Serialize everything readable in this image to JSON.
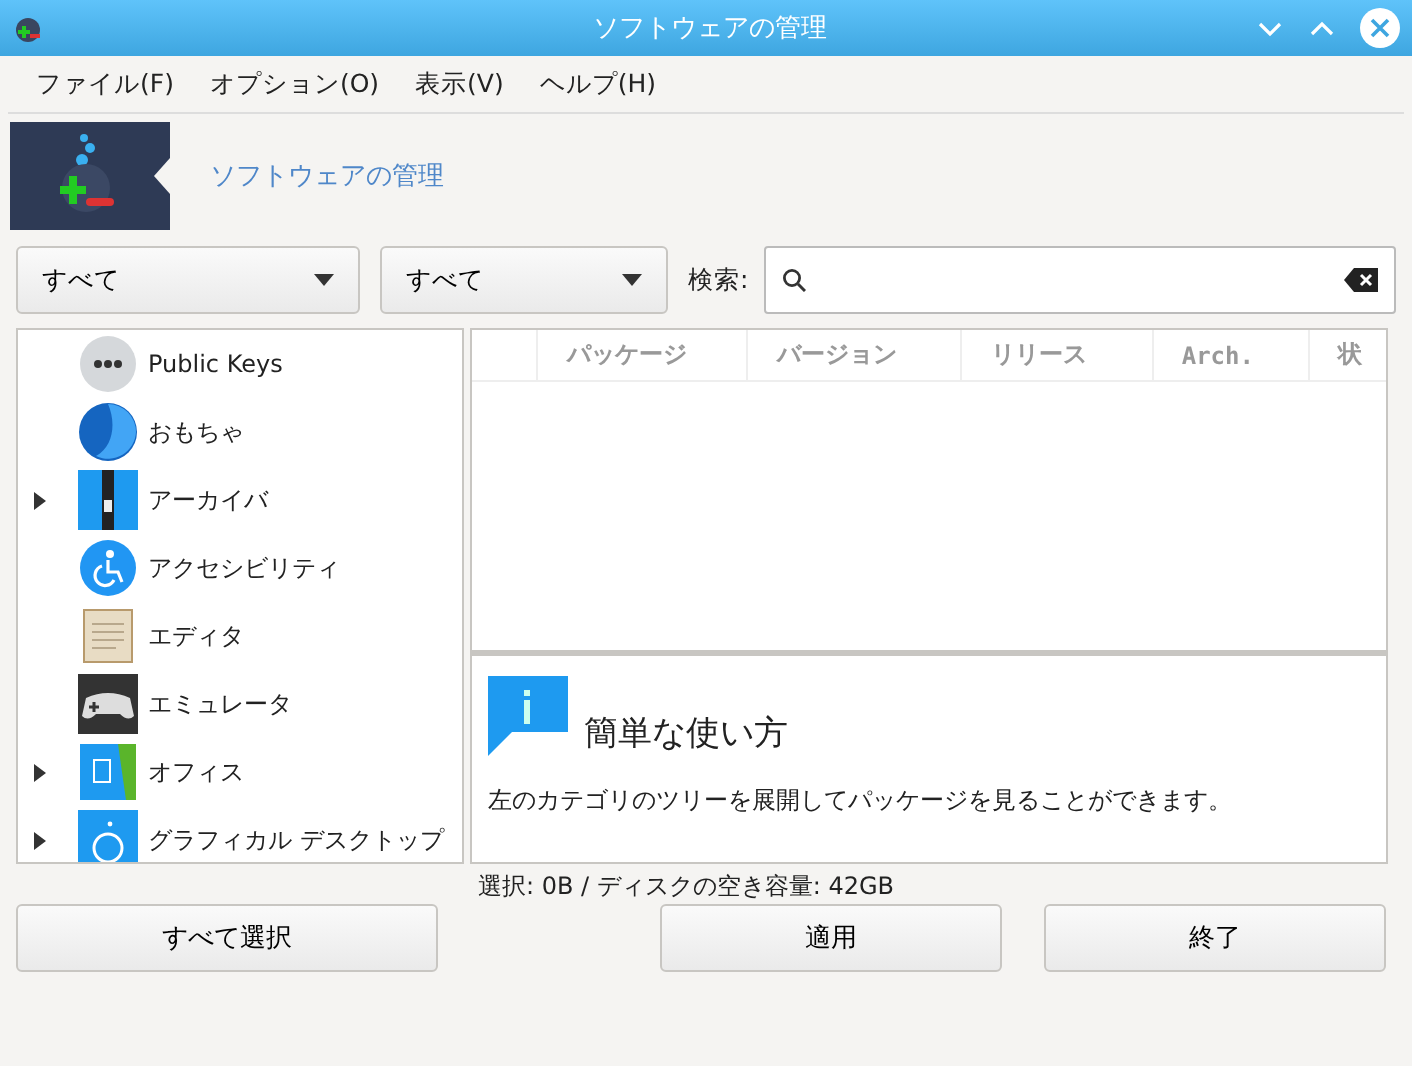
{
  "window": {
    "title": "ソフトウェアの管理"
  },
  "menu": [
    "ファイル(F)",
    "オプション(O)",
    "表示(V)",
    "ヘルプ(H)"
  ],
  "header": {
    "title": "ソフトウェアの管理"
  },
  "filters": [
    {
      "value": "すべて"
    },
    {
      "value": "すべて"
    }
  ],
  "search": {
    "label": "検索:"
  },
  "tree": [
    {
      "label": "Public Keys",
      "expandable": false
    },
    {
      "label": "おもちゃ",
      "expandable": false
    },
    {
      "label": "アーカイバ",
      "expandable": true
    },
    {
      "label": "アクセシビリティ",
      "expandable": false
    },
    {
      "label": "エディタ",
      "expandable": false
    },
    {
      "label": "エミュレータ",
      "expandable": false
    },
    {
      "label": "オフィス",
      "expandable": true
    },
    {
      "label": "グラフィカル デスクトップ",
      "expandable": true
    }
  ],
  "table": {
    "columns": [
      "パッケージ",
      "バージョン",
      "リリース",
      "Arch.",
      "状"
    ]
  },
  "help": {
    "title": "簡単な使い方",
    "text": "左のカテゴリのツリーを展開してパッケージを見ることができます。"
  },
  "status_bar": "選択: 0B / ディスクの空き容量: 42GB",
  "buttons": [
    "すべて選択",
    "適用",
    "終了"
  ]
}
